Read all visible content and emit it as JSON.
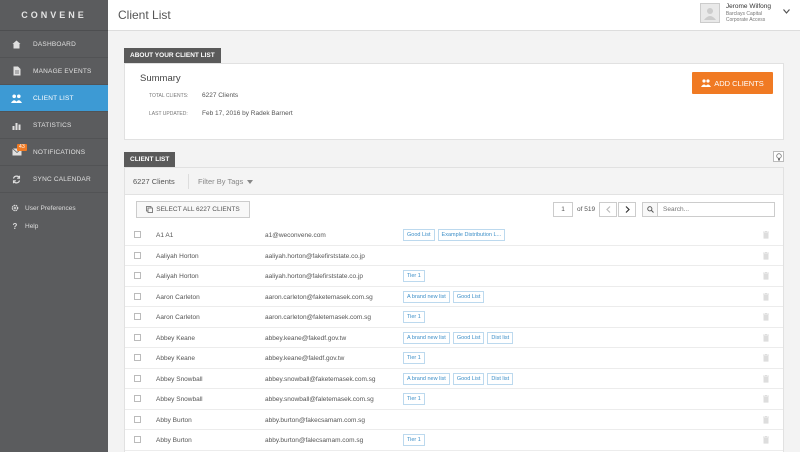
{
  "logo": "CONVENE",
  "nav": [
    {
      "label": "DASHBOARD",
      "icon": "dashboard-icon"
    },
    {
      "label": "MANAGE EVENTS",
      "icon": "document-icon"
    },
    {
      "label": "CLIENT LIST",
      "icon": "users-icon",
      "active": true
    },
    {
      "label": "STATISTICS",
      "icon": "bar-chart-icon"
    },
    {
      "label": "NOTIFICATIONS",
      "icon": "envelope-icon",
      "badge": "43"
    },
    {
      "label": "SYNC CALENDAR",
      "icon": "sync-icon"
    }
  ],
  "nav_secondary": [
    {
      "label": "User Preferences",
      "icon": "gear-icon"
    },
    {
      "label": "Help",
      "icon": "question-icon"
    }
  ],
  "header": {
    "title": "Client List",
    "user_name": "Jerome Wilfong",
    "user_line1": "Barclays Capital",
    "user_line2": "Corporate Access"
  },
  "about": {
    "tab_label": "ABOUT YOUR CLIENT LIST",
    "summary_title": "Summary",
    "total_label": "TOTAL CLIENTS:",
    "total_value": "6227 Clients",
    "updated_label": "LAST UPDATED:",
    "updated_value": "Feb 17, 2016 by Radek Barnert",
    "add_button": "ADD CLIENTS"
  },
  "list": {
    "tab_label": "CLIENT LIST",
    "count_text": "6227 Clients",
    "filter_label": "Filter By Tags",
    "select_all_label": "SELECT ALL 6227 CLIENTS",
    "page_value": "1",
    "page_of": "of 519",
    "search_placeholder": "Search...",
    "rows": [
      {
        "name": "A1 A1",
        "email": "a1@weconvene.com",
        "tags": [
          "Good List",
          "Example Distribution L..."
        ]
      },
      {
        "name": "Aaliyah Horton",
        "email": "aaliyah.horton@fakefirststate.co.jp",
        "tags": []
      },
      {
        "name": "Aaliyah Horton",
        "email": "aaliyah.horton@falefirststate.co.jp",
        "tags": [
          "Tier 1"
        ]
      },
      {
        "name": "Aaron Carleton",
        "email": "aaron.carleton@faketemasek.com.sg",
        "tags": [
          "A brand new list",
          "Good List"
        ]
      },
      {
        "name": "Aaron Carleton",
        "email": "aaron.carleton@faletemasek.com.sg",
        "tags": [
          "Tier 1"
        ]
      },
      {
        "name": "Abbey Keane",
        "email": "abbey.keane@fakedf.gov.tw",
        "tags": [
          "A brand new list",
          "Good List",
          "Dist list"
        ]
      },
      {
        "name": "Abbey Keane",
        "email": "abbey.keane@faledf.gov.tw",
        "tags": [
          "Tier 1"
        ]
      },
      {
        "name": "Abbey Snowball",
        "email": "abbey.snowball@faketemasek.com.sg",
        "tags": [
          "A brand new list",
          "Good List",
          "Dist list"
        ]
      },
      {
        "name": "Abbey Snowball",
        "email": "abbey.snowball@faletemasek.com.sg",
        "tags": [
          "Tier 1"
        ]
      },
      {
        "name": "Abby Burton",
        "email": "abby.burton@fakecsamam.com.sg",
        "tags": []
      },
      {
        "name": "Abby Burton",
        "email": "abby.burton@falecsamam.com.sg",
        "tags": [
          "Tier 1"
        ]
      }
    ]
  },
  "colors": {
    "accent": "#3d9ad4",
    "orange": "#f07a23",
    "sidebar": "#5b5c5e"
  }
}
